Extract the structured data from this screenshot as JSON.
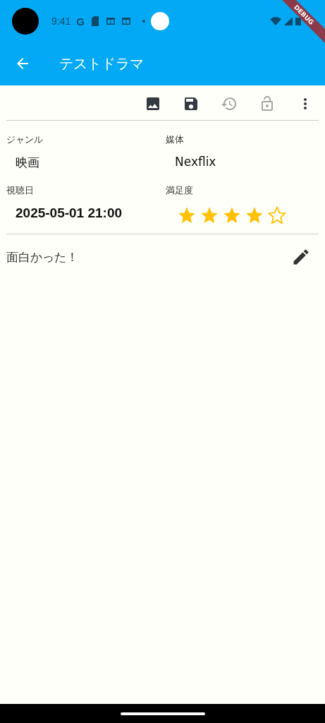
{
  "status_bar": {
    "time": "9:41",
    "google_glyph": "G"
  },
  "debug_banner": "DEBUG",
  "app_bar": {
    "title": "テストドラマ"
  },
  "toolbar": [
    {
      "kind": "image",
      "disabled": false
    },
    {
      "kind": "save",
      "disabled": false
    },
    {
      "kind": "history",
      "disabled": true
    },
    {
      "kind": "unlock",
      "disabled": true
    },
    {
      "kind": "more",
      "disabled": false
    }
  ],
  "fields": [
    {
      "kind": "text",
      "label": "ジャンル",
      "value": "映画"
    },
    {
      "kind": "text",
      "label": "媒体",
      "value": "Nexflix"
    },
    {
      "kind": "datetime",
      "label": "視聴日",
      "value": "2025-05-01 21:00"
    },
    {
      "kind": "rating",
      "label": "満足度",
      "stars": 4
    }
  ],
  "note": {
    "text": "面白かった！"
  }
}
